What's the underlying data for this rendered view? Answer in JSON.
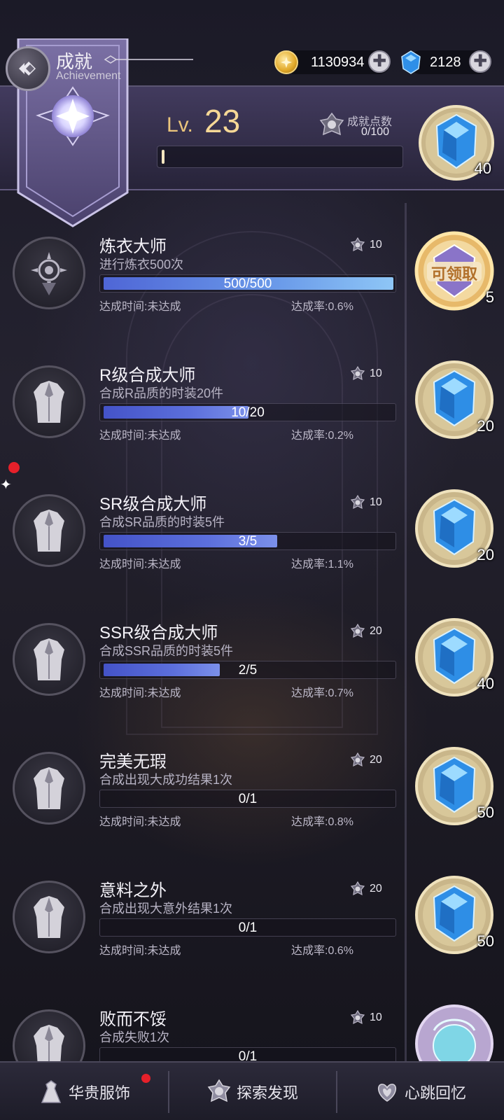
{
  "header": {
    "title_zh": "成就",
    "title_en": "Achievement",
    "gold": "1130934",
    "gems": "2128",
    "level_prefix": "Lv.",
    "level": "23",
    "points_label": "成就点数",
    "points_value": "0/100",
    "level_progress": 0.01,
    "level_reward_count": "40"
  },
  "achievements": [
    {
      "name": "炼衣大师",
      "desc": "进行炼衣500次",
      "points": "10",
      "progress_text": "500/500",
      "progress": 1.0,
      "time": "达成时间:未达成",
      "rate": "达成率:0.6%",
      "reward_count": "5",
      "reward_type": "claimable",
      "claim_label": "可领取",
      "icon": "sun-emblem-icon"
    },
    {
      "name": "R级合成大师",
      "desc": "合成R品质的时装20件",
      "points": "10",
      "progress_text": "10/20",
      "progress": 0.5,
      "time": "达成时间:未达成",
      "rate": "达成率:0.2%",
      "reward_count": "20",
      "reward_type": "gem",
      "icon": "coat-icon"
    },
    {
      "name": "SR级合成大师",
      "desc": "合成SR品质的时装5件",
      "points": "10",
      "progress_text": "3/5",
      "progress": 0.6,
      "time": "达成时间:未达成",
      "rate": "达成率:1.1%",
      "reward_count": "20",
      "reward_type": "gem",
      "icon": "coat-icon"
    },
    {
      "name": "SSR级合成大师",
      "desc": "合成SSR品质的时装5件",
      "points": "20",
      "progress_text": "2/5",
      "progress": 0.4,
      "time": "达成时间:未达成",
      "rate": "达成率:0.7%",
      "reward_count": "40",
      "reward_type": "gem",
      "icon": "coat-icon"
    },
    {
      "name": "完美无瑕",
      "desc": "合成出现大成功结果1次",
      "points": "20",
      "progress_text": "0/1",
      "progress": 0,
      "time": "达成时间:未达成",
      "rate": "达成率:0.8%",
      "reward_count": "50",
      "reward_type": "gem",
      "icon": "coat-icon"
    },
    {
      "name": "意料之外",
      "desc": "合成出现大意外结果1次",
      "points": "20",
      "progress_text": "0/1",
      "progress": 0,
      "time": "达成时间:未达成",
      "rate": "达成率:0.6%",
      "reward_count": "50",
      "reward_type": "gem",
      "icon": "coat-icon"
    },
    {
      "name": "败而不馁",
      "desc": "合成失败1次",
      "points": "10",
      "progress_text": "0/1",
      "progress": 0,
      "time": "",
      "rate": "",
      "reward_count": "",
      "reward_type": "orb",
      "icon": "coat-icon"
    }
  ],
  "nav": [
    {
      "label": "华贵服饰",
      "icon": "dress-icon",
      "badge": true
    },
    {
      "label": "探索发现",
      "icon": "compass-emblem-icon",
      "badge": false
    },
    {
      "label": "心跳回忆",
      "icon": "heart-emblem-icon",
      "badge": false
    }
  ],
  "colors": {
    "accent_gold": "#ebc57c",
    "progress_blue": "#5c6fdc",
    "badge_red": "#e6202a"
  }
}
